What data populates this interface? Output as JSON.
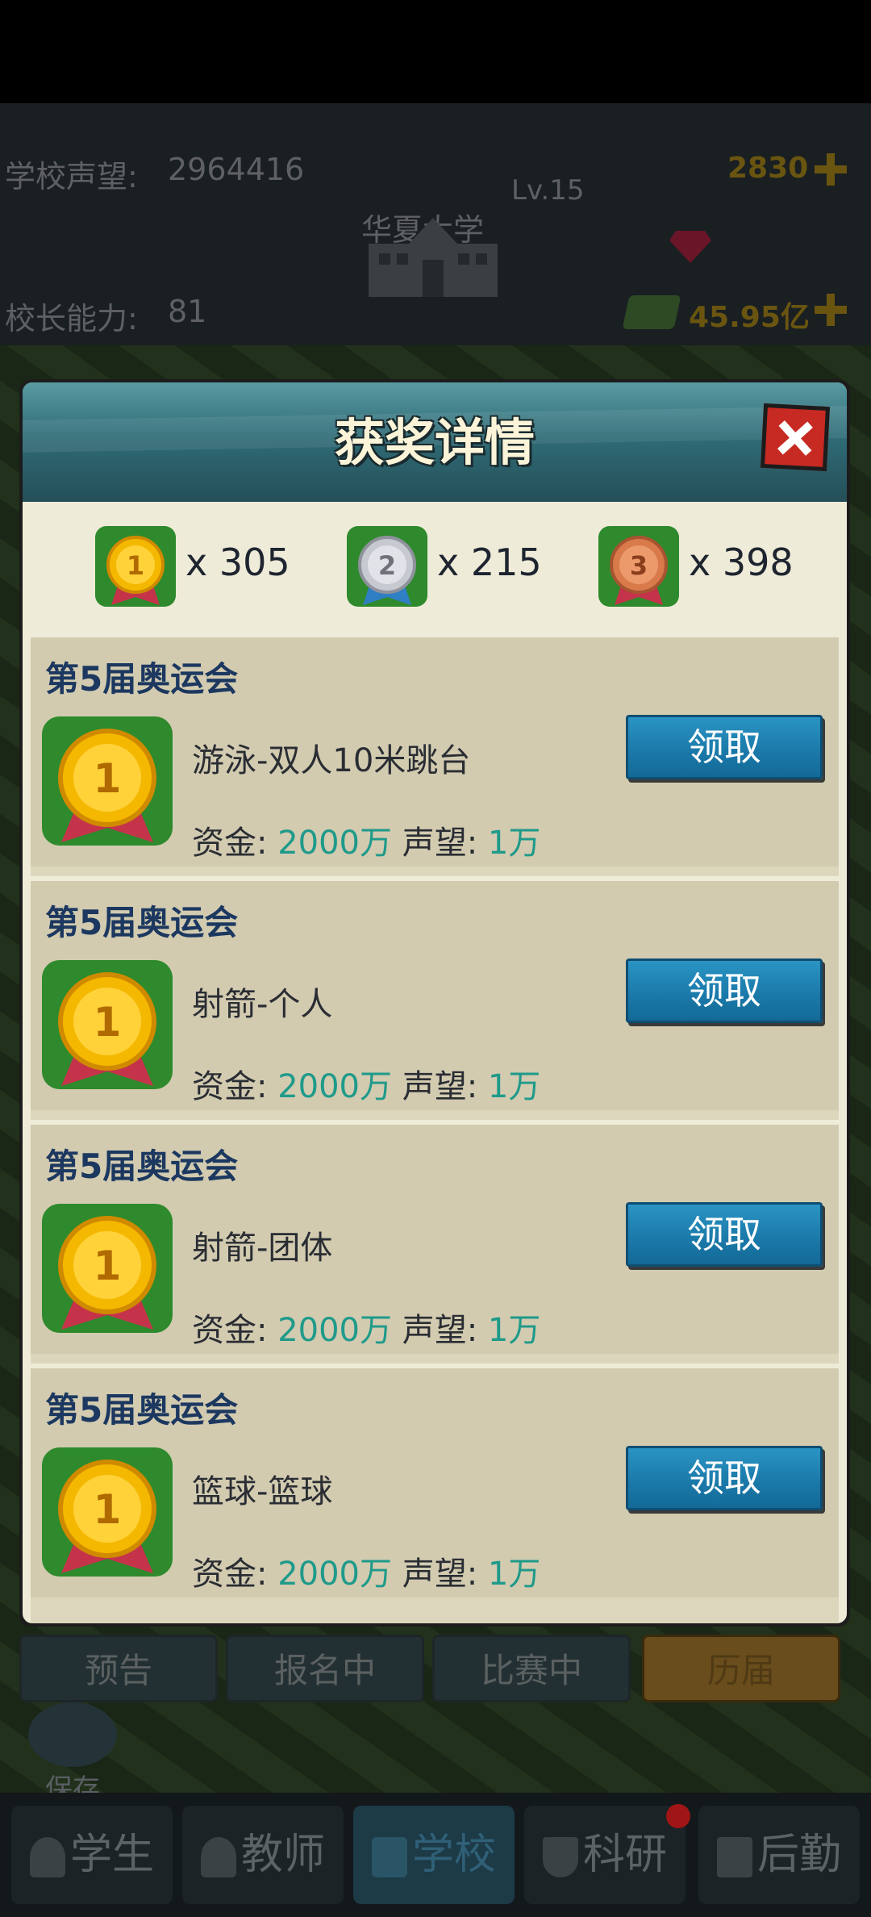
{
  "hud": {
    "reputation_label": "学校声望:",
    "reputation_value": "2964416",
    "ability_label": "校长能力:",
    "ability_value": "81",
    "level": "Lv.15",
    "school_name": "华夏大学",
    "gems": "2830",
    "money": "45.95亿"
  },
  "modal": {
    "title": "获奖详情",
    "summary": [
      {
        "rank": "1",
        "count": "x 305",
        "color": "#f5b800"
      },
      {
        "rank": "2",
        "count": "x 215",
        "color": "#c7c9d1"
      },
      {
        "rank": "3",
        "count": "x 398",
        "color": "#d87a4a"
      }
    ],
    "awards": [
      {
        "games": "第5届奥运会",
        "event": "游泳-双人10米跳台",
        "fund_label": "资金:",
        "fund": "2000万",
        "rep_label": "声望:",
        "rep": "1万",
        "button": "领取"
      },
      {
        "games": "第5届奥运会",
        "event": "射箭-个人",
        "fund_label": "资金:",
        "fund": "2000万",
        "rep_label": "声望:",
        "rep": "1万",
        "button": "领取"
      },
      {
        "games": "第5届奥运会",
        "event": "射箭-团体",
        "fund_label": "资金:",
        "fund": "2000万",
        "rep_label": "声望:",
        "rep": "1万",
        "button": "领取"
      },
      {
        "games": "第5届奥运会",
        "event": "篮球-篮球",
        "fund_label": "资金:",
        "fund": "2000万",
        "rep_label": "声望:",
        "rep": "1万",
        "button": "领取"
      }
    ]
  },
  "under_tabs": [
    "预告",
    "报名中",
    "比赛中",
    "历届"
  ],
  "save_label": "保存",
  "bottom_nav": [
    "学生",
    "教师",
    "学校",
    "科研",
    "后勤"
  ]
}
